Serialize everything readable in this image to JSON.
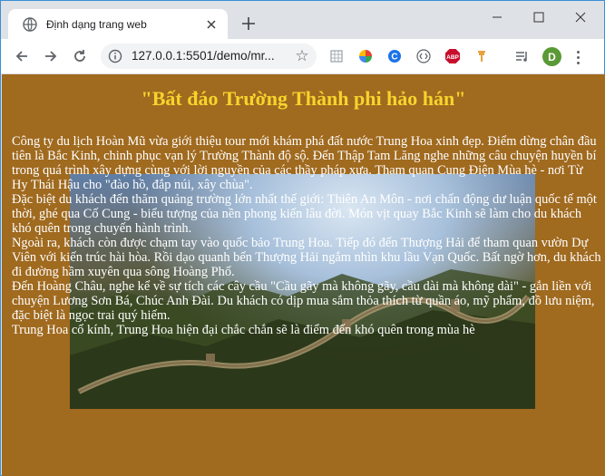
{
  "browser": {
    "tab_title": "Định dạng trang web",
    "url": "127.0.0.1:5501/demo/mr...",
    "profile_initial": "D",
    "extensions": [
      "grid-icon",
      "color-wheel-icon",
      "c-icon",
      "bracket-icon",
      "abp-icon",
      "pin-icon",
      "playlist-icon"
    ],
    "abp_label": "ABP",
    "c_label": "C",
    "colors": {
      "frame": "#dee1e6",
      "accent": "#3a8fd8"
    }
  },
  "page": {
    "background": "#a06a1f",
    "heading": "\"Bất đáo Trường Thành phi hảo hán\"",
    "heading_color": "#f7d42c",
    "paragraphs": [
      "Công ty du lịch Hoàn Mũ vừa giới thiệu tour mới khám phá đất nước Trung Hoa xinh đẹp. Điểm dừng chân đầu tiên là Bắc Kinh, chinh phục vạn lý Trường Thành độ sộ. Đến Thập Tam Lăng nghe những câu chuyện huyền bí trong quá trình xây dựng cùng với lời nguyền của các thầy pháp xưa. Tham quan Cung Điện Mùa hè - nơi Từ Hy Thái Hậu cho \"đào hồ, đắp núi, xây chùa\".",
      "Đặc biệt du khách đến thăm quảng trường lớn nhất thế giới: Thiên An Môn - nơi chấn động dư luận quốc tế một thời, ghé qua Cố Cung - biểu tượng của nền phong kiến lâu đời. Món vịt quay Bắc Kinh sẽ làm cho du khách khó quên trong chuyến hành trình.",
      "Ngoài ra, khách còn được chạm tay vào quốc bảo Trung Hoa. Tiếp đó đến Thượng Hải để tham quan vườn Dự Viên với kiến trúc hài hòa. Rồi dạo quanh bến Thượng Hải ngắm nhìn khu lầu Vạn Quốc. Bất ngờ hơn, du khách đi đường hầm xuyên qua sông Hoàng Phố.",
      "Đến Hoàng Châu, nghe kể về sự tích các cây cầu \"Cầu gãy mà không gãy, cầu dài mà không dài\" - gắn liền với chuyện Lương Sơn Bá, Chúc Anh Đài. Du khách có dịp mua sắm thỏa thích từ quần áo, mỹ phẩm, đồ lưu niệm, đặc biệt là ngọc trai quý hiếm.",
      "Trung Hoa cổ kính, Trung Hoa hiện đại chắc chắn sẽ là điểm đến khó quên trong mùa hè"
    ]
  }
}
